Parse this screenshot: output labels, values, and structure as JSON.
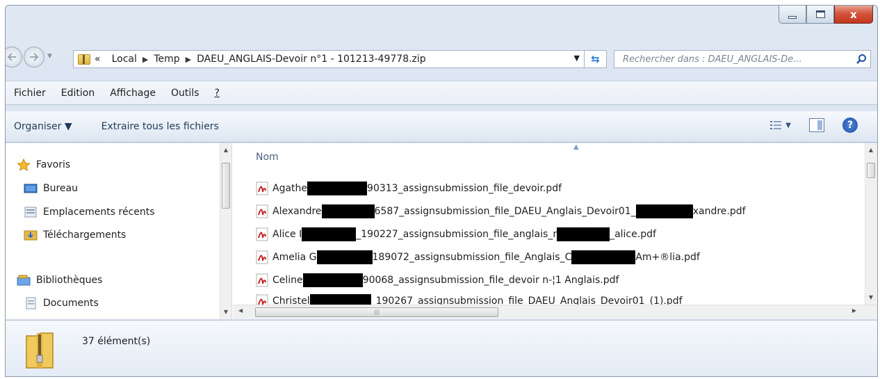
{
  "window": {
    "caption": {
      "minimize": "minimize",
      "maximize": "maximize",
      "close": "x"
    }
  },
  "address": {
    "prefix": "«",
    "crumbs": [
      "Local",
      "Temp",
      "DAEU_ANGLAIS-Devoir n°1 - 101213-49778.zip"
    ]
  },
  "search": {
    "placeholder": "Rechercher dans : DAEU_ANGLAIS-De..."
  },
  "menu": [
    "Fichier",
    "Edition",
    "Affichage",
    "Outils",
    "?"
  ],
  "commands": {
    "organize": "Organiser ▼",
    "extract": "Extraire tous les fichiers"
  },
  "nav": {
    "favorites": "Favoris",
    "favorites_items": [
      "Bureau",
      "Emplacements récents",
      "Téléchargements"
    ],
    "libraries": "Bibliothèques",
    "library_items": [
      "Documents"
    ]
  },
  "file_list": {
    "column_name": "Nom",
    "files": [
      {
        "start": "Agathe",
        "mid": "90313_assignsubmission_file_devoir.pdf",
        "end": ""
      },
      {
        "start": "Alexandre",
        "mid": "6587_assignsubmission_file_DAEU_Anglais_Devoir01_",
        "end": "xandre.pdf"
      },
      {
        "start": "Alice I",
        "mid": "_190227_assignsubmission_file_anglais_r",
        "end": "_alice.pdf"
      },
      {
        "start": "Amelia G",
        "mid": "189072_assignsubmission_file_Anglais_C",
        "end": "Am+®lia.pdf"
      },
      {
        "start": "Celine",
        "mid": "90068_assignsubmission_file_devoir n-¦1 Anglais.pdf",
        "end": ""
      },
      {
        "start": "Christel",
        "mid": "_190267_assignsubmission_file_DAEU_Anglais_Devoir01_(1).pdf",
        "end": ""
      }
    ]
  },
  "status": {
    "count": "37 élément(s)"
  },
  "icons": {
    "back": "arrow-left-icon",
    "forward": "arrow-right-icon",
    "refresh": "refresh-icon",
    "search": "search-icon",
    "star": "star-icon",
    "pdf": "pdf-icon",
    "zip": "zip-folder-icon"
  },
  "colors": {
    "accent": "#2c7bd6",
    "close": "#c3371c",
    "pdf_red": "#c62828"
  }
}
